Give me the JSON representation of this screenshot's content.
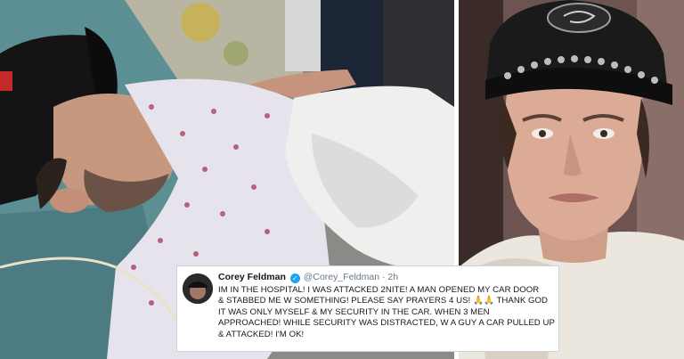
{
  "tweet": {
    "name": "Corey Feldman",
    "verified_icon": "verified-badge-icon",
    "handle": "@Corey_Feldman",
    "separator": "·",
    "time": "2h",
    "lines": [
      "IM IN THE HOSPITAL! I WAS ATTACKED 2NITE! A MAN OPENED MY CAR DOOR",
      "& STABBED ME W SOMETHING! PLEASE SAY PRAYERS 4 US! 🙏🙏 THANK GOD",
      "IT WAS ONLY MYSELF & MY SECURITY IN THE CAR. WHEN 3 MEN",
      "APPROACHED! WHILE SECURITY WAS DISTRACTED, W A GUY A CAR PULLED UP",
      "& ATTACKED! I'M OK!"
    ]
  },
  "photos": {
    "left": "hospital-bed-photo",
    "right": "selfie-photo"
  },
  "colors": {
    "verified": "#1da1f2",
    "tweet_border": "#c9d3dc",
    "name": "#14171a",
    "handle": "#657786"
  }
}
